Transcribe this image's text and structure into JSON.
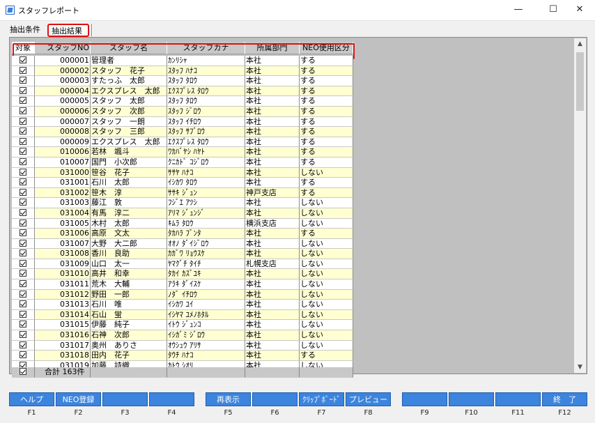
{
  "window": {
    "title": "スタッフレポート",
    "minimize": "—",
    "maximize": "☐",
    "close": "✕"
  },
  "tabs": [
    {
      "label": "抽出条件"
    },
    {
      "label": "抽出結果"
    }
  ],
  "grid": {
    "columns": [
      "対象",
      "スタッフNO",
      "スタッフ名",
      "スタッフカナ",
      "所属部門",
      "NEO使用区分"
    ],
    "rows": [
      [
        "000001",
        "管理者",
        "ｶﾝﾘｼｬ",
        "本社",
        "する"
      ],
      [
        "000002",
        "スタッフ　花子",
        "ｽﾀｯﾌ ﾊﾅｺ",
        "本社",
        "する"
      ],
      [
        "000003",
        "すたっふ　太郎",
        "ｽﾀｯﾌ ﾀﾛｳ",
        "本社",
        "する"
      ],
      [
        "000004",
        "エクスプレス　太郎",
        "ｴｸｽﾌﾟﾚｽ ﾀﾛｳ",
        "本社",
        "する"
      ],
      [
        "000005",
        "スタッフ　太郎",
        "ｽﾀｯﾌ ﾀﾛｳ",
        "本社",
        "する"
      ],
      [
        "000006",
        "スタッフ　次郎",
        "ｽﾀｯﾌ ｼﾞﾛｳ",
        "本社",
        "する"
      ],
      [
        "000007",
        "スタッフ　一朗",
        "ｽﾀｯﾌ ｲﾁﾛｳ",
        "本社",
        "する"
      ],
      [
        "000008",
        "スタッフ　三郎",
        "ｽﾀｯﾌ ｻﾌﾞﾛｳ",
        "本社",
        "する"
      ],
      [
        "000009",
        "エクスプレス　太郎",
        "ｴｸｽﾌﾟﾚｽ ﾀﾛｳ",
        "本社",
        "する"
      ],
      [
        "010006",
        "若林　颯斗",
        "ﾜｶﾊﾞﾔｼ ﾊﾔﾄ",
        "本社",
        "する"
      ],
      [
        "010007",
        "国門　小次郎",
        "ｸﾆｶﾄﾞ ｺｼﾞﾛｳ",
        "本社",
        "する"
      ],
      [
        "031000",
        "笹谷　花子",
        "ｻｻﾔ ﾊﾅｺ",
        "本社",
        "しない"
      ],
      [
        "031001",
        "石川　太郎",
        "ｲｼｶﾜ ﾀﾛｳ",
        "本社",
        "する"
      ],
      [
        "031002",
        "笹木　淳",
        "ｻｻｷ ｼﾞｭﾝ",
        "神戸支店",
        "する"
      ],
      [
        "031003",
        "藤江　敦",
        "ﾌｼﾞｴ ｱﾂｼ",
        "本社",
        "しない"
      ],
      [
        "031004",
        "有馬　淳二",
        "ｱﾘﾏ ｼﾞｭﾝｼﾞ",
        "本社",
        "しない"
      ],
      [
        "031005",
        "木村　太郎",
        "ｷﾑﾗ ﾀﾛｳ",
        "横浜支店",
        "しない"
      ],
      [
        "031006",
        "高原　文太",
        "ﾀｶﾊﾗ ﾌﾞﾝﾀ",
        "本社",
        "する"
      ],
      [
        "031007",
        "大野　大二郎",
        "ｵｵﾉ ﾀﾞｲｼﾞﾛｳ",
        "本社",
        "しない"
      ],
      [
        "031008",
        "香川　良助",
        "ｶｶﾞﾜ ﾘｮｳｽｹ",
        "本社",
        "しない"
      ],
      [
        "031009",
        "山口　太一",
        "ﾔﾏｸﾞﾁ ﾀｲﾁ",
        "札幌支店",
        "しない"
      ],
      [
        "031010",
        "高井　和幸",
        "ﾀｶｲ ｶｽﾞﾕｷ",
        "本社",
        "しない"
      ],
      [
        "031011",
        "荒木　大輔",
        "ｱﾗｷ ﾀﾞｲｽｹ",
        "本社",
        "しない"
      ],
      [
        "031012",
        "野田　一郎",
        "ﾉﾀﾞ ｲﾁﾛｳ",
        "本社",
        "しない"
      ],
      [
        "031013",
        "石川　唯",
        "ｲｼｶﾜ ﾕｲ",
        "本社",
        "しない"
      ],
      [
        "031014",
        "石山　蛍",
        "ｲｼﾔﾏ ﾕﾒﾉﾎﾀﾙ",
        "本社",
        "しない"
      ],
      [
        "031015",
        "伊藤　純子",
        "ｲﾄｳ ｼﾞｭﾝｺ",
        "本社",
        "しない"
      ],
      [
        "031016",
        "石神　次郎",
        "ｲｼｶﾞﾐ ｼﾞﾛｳ",
        "本社",
        "しない"
      ],
      [
        "031017",
        "奥州　ありさ",
        "ｵｳｼｭｳ ｱﾘｻ",
        "本社",
        "しない"
      ],
      [
        "031018",
        "田内　花子",
        "ﾀｳﾁ ﾊﾅｺ",
        "本社",
        "する"
      ],
      [
        "031019",
        "加藤　詩織",
        "ｶﾄｳ ｼｵﾘ",
        "本社",
        "しない"
      ]
    ],
    "footer": {
      "total_label": "合計 163件"
    }
  },
  "function_keys": [
    {
      "label": "ヘルプ",
      "key": "F1"
    },
    {
      "label": "NEO登録",
      "key": "F2"
    },
    {
      "label": "",
      "key": "F3"
    },
    {
      "label": "",
      "key": "F4"
    },
    {
      "label": "再表示",
      "key": "F5"
    },
    {
      "label": "",
      "key": "F6"
    },
    {
      "label": "ｸﾘｯﾌﾟﾎﾞｰﾄﾞ",
      "key": "F7"
    },
    {
      "label": "プレビュー",
      "key": "F8"
    },
    {
      "label": "",
      "key": "F9"
    },
    {
      "label": "",
      "key": "F10"
    },
    {
      "label": "",
      "key": "F11"
    },
    {
      "label": "終　了",
      "key": "F12"
    }
  ],
  "scrollbar": {
    "up": "▲",
    "down": "▼"
  }
}
